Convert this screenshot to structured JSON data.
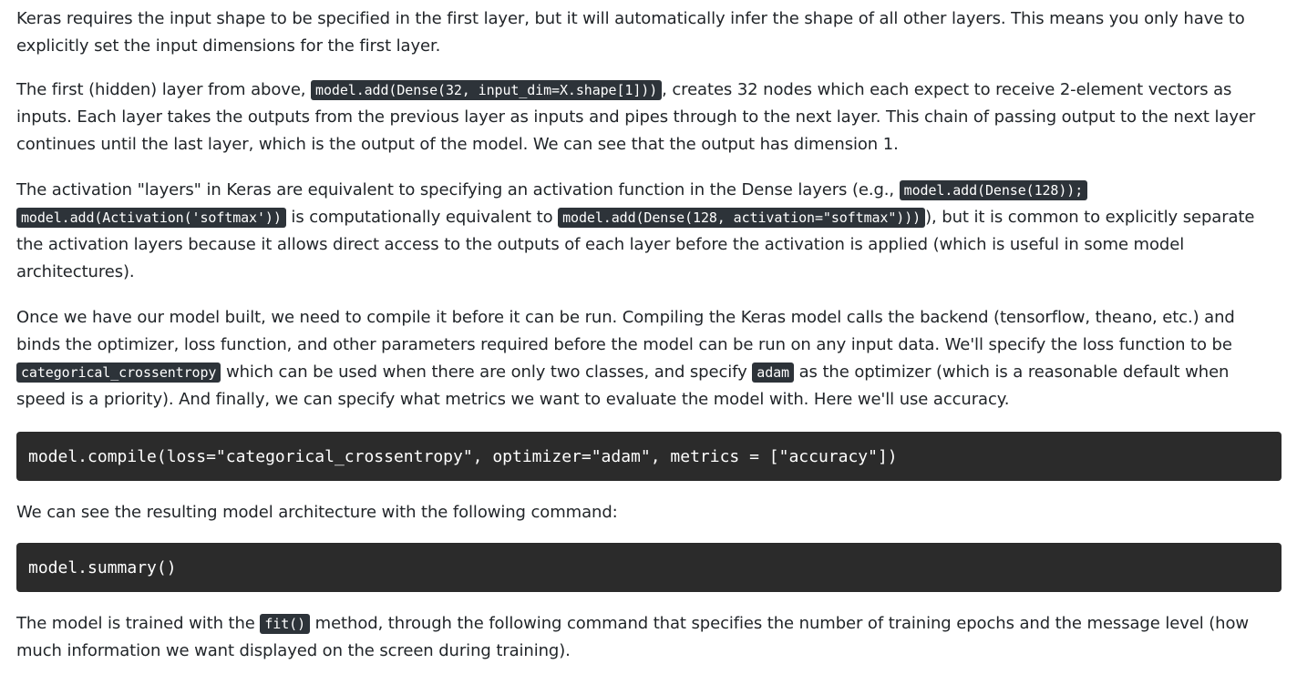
{
  "paragraphs": {
    "p1": {
      "text": "Keras requires the input shape to be specified in the first layer, but it will automatically infer the shape of all other layers. This means you only have to explicitly set the input dimensions for the first layer."
    },
    "p2": {
      "t1": "The first (hidden) layer from above, ",
      "c1": "model.add(Dense(32, input_dim=X.shape[1]))",
      "t2": ", creates 32 nodes which each expect to receive 2-element vectors as inputs. Each layer takes the outputs from the previous layer as inputs and pipes through to the next layer. This chain of passing output to the next layer continues until the last layer, which is the output of the model. We can see that the output has dimension 1."
    },
    "p3": {
      "t1": "The activation \"layers\" in Keras are equivalent to specifying an activation function in the Dense layers (e.g., ",
      "c1": "model.add(Dense(128)); model.add(Activation('softmax'))",
      "t2": " is computationally equivalent to ",
      "c2": "model.add(Dense(128, activation=\"softmax\")))",
      "t3": "), but it is common to explicitly separate the activation layers because it allows direct access to the outputs of each layer before the activation is applied (which is useful in some model architectures)."
    },
    "p4": {
      "t1": "Once we have our model built, we need to compile it before it can be run. Compiling the Keras model calls the backend (tensorflow, theano, etc.) and binds the optimizer, loss function, and other parameters required before the model can be run on any input data. We'll specify the loss function to be ",
      "c1": "categorical_crossentropy",
      "t2": " which can be used when there are only two classes, and specify ",
      "c2": "adam",
      "t3": " as the optimizer (which is a reasonable default when speed is a priority). And finally, we can specify what metrics we want to evaluate the model with. Here we'll use accuracy."
    },
    "p5": {
      "text": "We can see the resulting model architecture with the following command:"
    },
    "p6": {
      "t1": "The model is trained with the ",
      "c1": "fit()",
      "t2": " method, through the following command that specifies the number of training epochs and the message level (how much information we want displayed on the screen during training)."
    }
  },
  "code_blocks": {
    "compile": "model.compile(loss=\"categorical_crossentropy\", optimizer=\"adam\", metrics = [\"accuracy\"])",
    "summary": "model.summary()"
  }
}
